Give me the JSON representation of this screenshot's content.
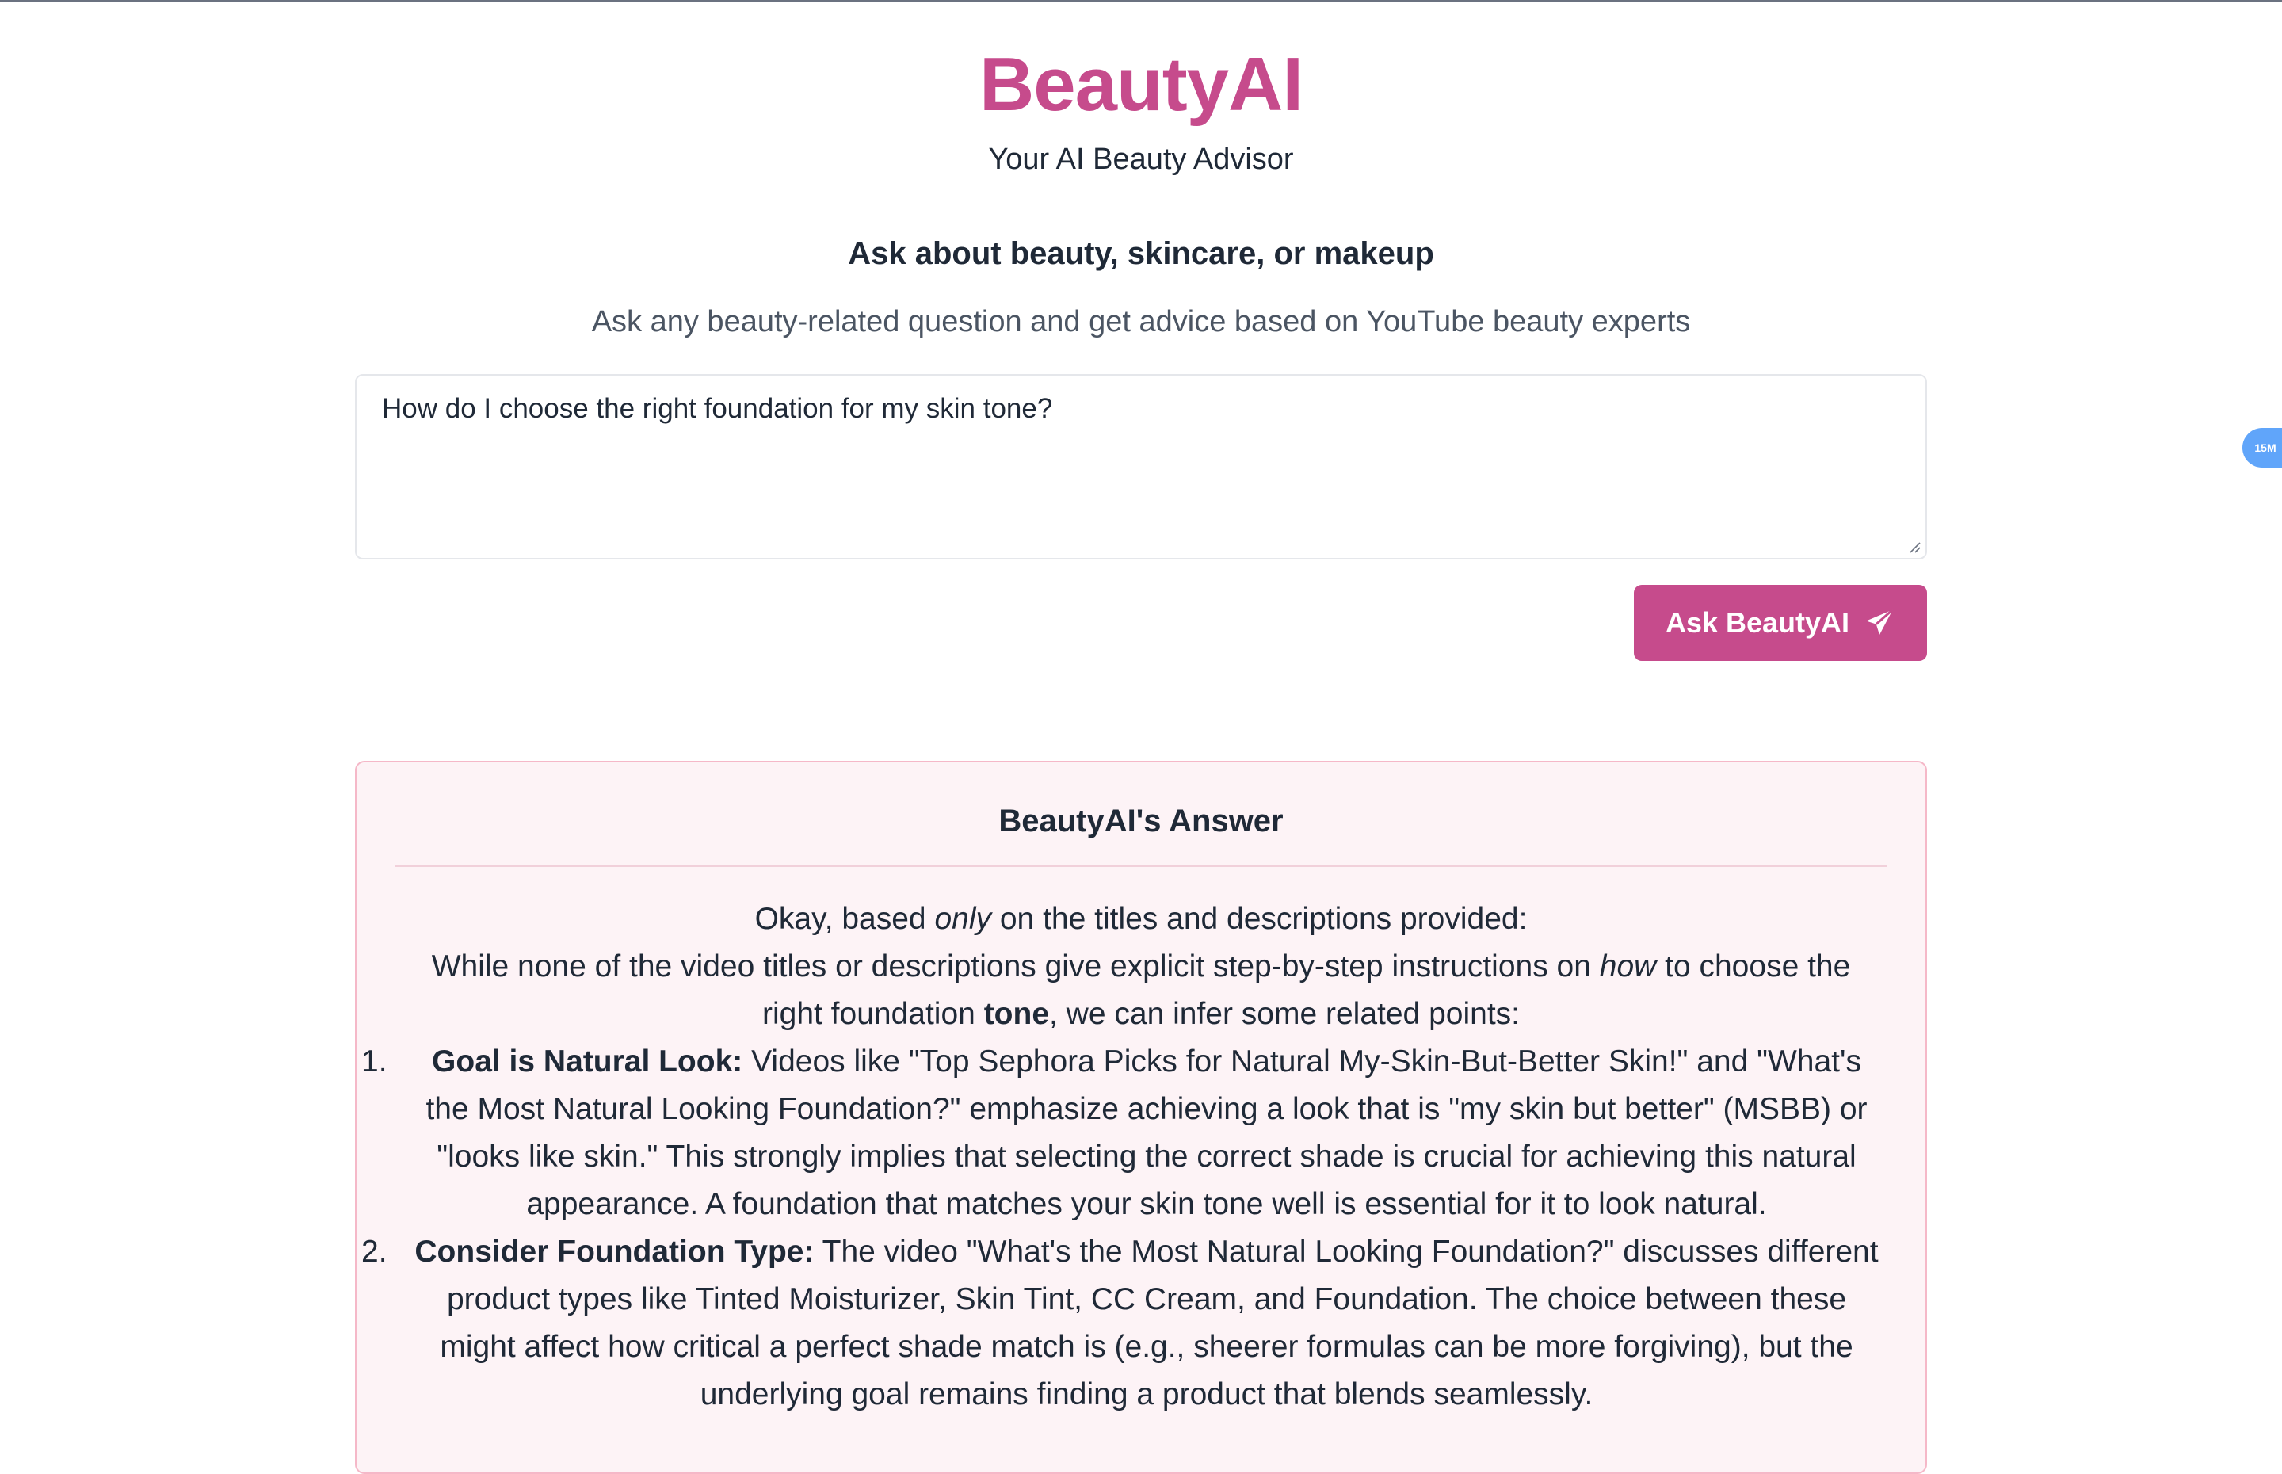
{
  "header": {
    "title": "BeautyAI",
    "subtitle": "Your AI Beauty Advisor"
  },
  "ask_section": {
    "heading": "Ask about beauty, skincare, or makeup",
    "description": "Ask any beauty-related question and get advice based on YouTube beauty experts",
    "question_value": "How do I choose the right foundation for my skin tone?",
    "button_label": "Ask BeautyAI",
    "button_icon": "paper-plane-icon"
  },
  "floating_badge": {
    "label": "15M"
  },
  "answer": {
    "title": "BeautyAI's Answer",
    "intro_1_a": "Okay, based ",
    "intro_1_em": "only",
    "intro_1_b": " on the titles and descriptions provided:",
    "intro_2_a": "While none of the video titles or descriptions give explicit step-by-step instructions on ",
    "intro_2_em": "how",
    "intro_2_b": " to choose the right foundation ",
    "intro_2_strong": "tone",
    "intro_2_c": ", we can infer some related points:",
    "items": [
      {
        "number": "1.",
        "heading": "Goal is Natural Look:",
        "text": " Videos like \"Top Sephora Picks for Natural My-Skin-But-Better Skin!\" and \"What's the Most Natural Looking Foundation?\" emphasize achieving a look that is \"my skin but better\" (MSBB) or \"looks like skin.\" This strongly implies that selecting the correct shade is crucial for achieving this natural appearance. A foundation that matches your skin tone well is essential for it to look natural."
      },
      {
        "number": "2.",
        "heading": "Consider Foundation Type:",
        "text": " The video \"What's the Most Natural Looking Foundation?\" discusses different product types like Tinted Moisturizer, Skin Tint, CC Cream, and Foundation. The choice between these might affect how critical a perfect shade match is (e.g., sheerer formulas can be more forgiving), but the underlying goal remains finding a product that blends seamlessly."
      }
    ]
  },
  "colors": {
    "brand": "#c64b8c",
    "card_bg": "#fdf3f6",
    "card_border": "#f5b8c8",
    "badge": "#60a5fa"
  }
}
